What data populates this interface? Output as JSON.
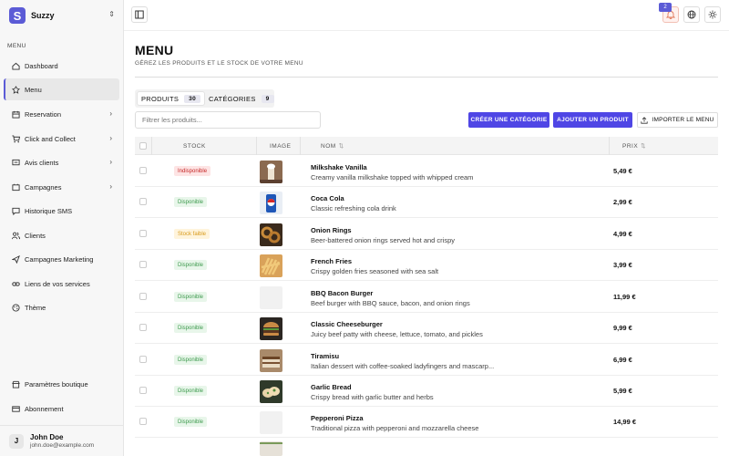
{
  "brand": {
    "name": "Suzzy",
    "logo_letter": "S"
  },
  "sidebar": {
    "section": "MENU",
    "items": [
      {
        "label": "Dashboard",
        "icon": "home-icon",
        "chevron": false,
        "active": false
      },
      {
        "label": "Menu",
        "icon": "flower-icon",
        "chevron": false,
        "active": true
      },
      {
        "label": "Reservation",
        "icon": "calendar-icon",
        "chevron": true,
        "active": false
      },
      {
        "label": "Click and Collect",
        "icon": "cart-icon",
        "chevron": true,
        "active": false
      },
      {
        "label": "Avis clients",
        "icon": "message-icon",
        "chevron": true,
        "active": false
      },
      {
        "label": "Campagnes",
        "icon": "megaphone-icon",
        "chevron": true,
        "active": false
      },
      {
        "label": "Historique SMS",
        "icon": "chat-icon",
        "chevron": false,
        "active": false
      },
      {
        "label": "Clients",
        "icon": "users-icon",
        "chevron": false,
        "active": false
      },
      {
        "label": "Campagnes Marketing",
        "icon": "send-icon",
        "chevron": false,
        "active": false
      },
      {
        "label": "Liens de vos services",
        "icon": "link-icon",
        "chevron": false,
        "active": false
      },
      {
        "label": "Thème",
        "icon": "palette-icon",
        "chevron": false,
        "active": false
      }
    ],
    "bottom": [
      {
        "label": "Paramètres boutique",
        "icon": "store-icon"
      },
      {
        "label": "Abonnement",
        "icon": "card-icon"
      }
    ],
    "user": {
      "initial": "J",
      "name": "John Doe",
      "email": "john.doe@example.com"
    }
  },
  "topbar": {
    "notification_count": "2"
  },
  "page": {
    "title": "MENU",
    "subtitle": "GÉREZ LES PRODUITS ET LE STOCK DE VOTRE MENU"
  },
  "tabs": [
    {
      "label": "PRODUITS",
      "count": "30"
    },
    {
      "label": "CATÉGORIES",
      "count": "9"
    }
  ],
  "search": {
    "placeholder": "Filtrer les produits..."
  },
  "actions": {
    "create_category": "CRÉER UNE CATÉGORIE",
    "add_product": "AJOUTER UN PRODUIT",
    "import_menu": "IMPORTER LE MENU"
  },
  "table": {
    "columns": {
      "stock": "STOCK",
      "image": "IMAGE",
      "name": "NOM",
      "price": "PRIX"
    },
    "rows": [
      {
        "stock": "Indisponible",
        "status": "red",
        "name": "Milkshake Vanilla",
        "description": "Creamy vanilla milkshake topped with whipped cream",
        "price": "5,49 €",
        "image": "milkshake"
      },
      {
        "stock": "Disponible",
        "status": "green",
        "name": "Coca Cola",
        "description": "Classic refreshing cola drink",
        "price": "2,99 €",
        "image": "cola"
      },
      {
        "stock": "Stock faible",
        "status": "amber",
        "name": "Onion Rings",
        "description": "Beer-battered onion rings served hot and crispy",
        "price": "4,99 €",
        "image": "rings"
      },
      {
        "stock": "Disponible",
        "status": "green",
        "name": "French Fries",
        "description": "Crispy golden fries seasoned with sea salt",
        "price": "3,99 €",
        "image": "fries"
      },
      {
        "stock": "Disponible",
        "status": "green",
        "name": "BBQ Bacon Burger",
        "description": "Beef burger with BBQ sauce, bacon, and onion rings",
        "price": "11,99 €",
        "image": "none"
      },
      {
        "stock": "Disponible",
        "status": "green",
        "name": "Classic Cheeseburger",
        "description": "Juicy beef patty with cheese, lettuce, tomato, and pickles",
        "price": "9,99 €",
        "image": "burger"
      },
      {
        "stock": "Disponible",
        "status": "green",
        "name": "Tiramisu",
        "description": "Italian dessert with coffee-soaked ladyfingers and mascarp...",
        "price": "6,99 €",
        "image": "tiramisu"
      },
      {
        "stock": "Disponible",
        "status": "green",
        "name": "Garlic Bread",
        "description": "Crispy bread with garlic butter and herbs",
        "price": "5,99 €",
        "image": "garlic"
      },
      {
        "stock": "Disponible",
        "status": "green",
        "name": "Pepperoni Pizza",
        "description": "Traditional pizza with pepperoni and mozzarella cheese",
        "price": "14,99 €",
        "image": "none"
      }
    ]
  },
  "colors": {
    "accent": "#4f46e5",
    "unavailable": "#c62828",
    "available": "#3d9a4d",
    "low_stock": "#d89a1b"
  }
}
